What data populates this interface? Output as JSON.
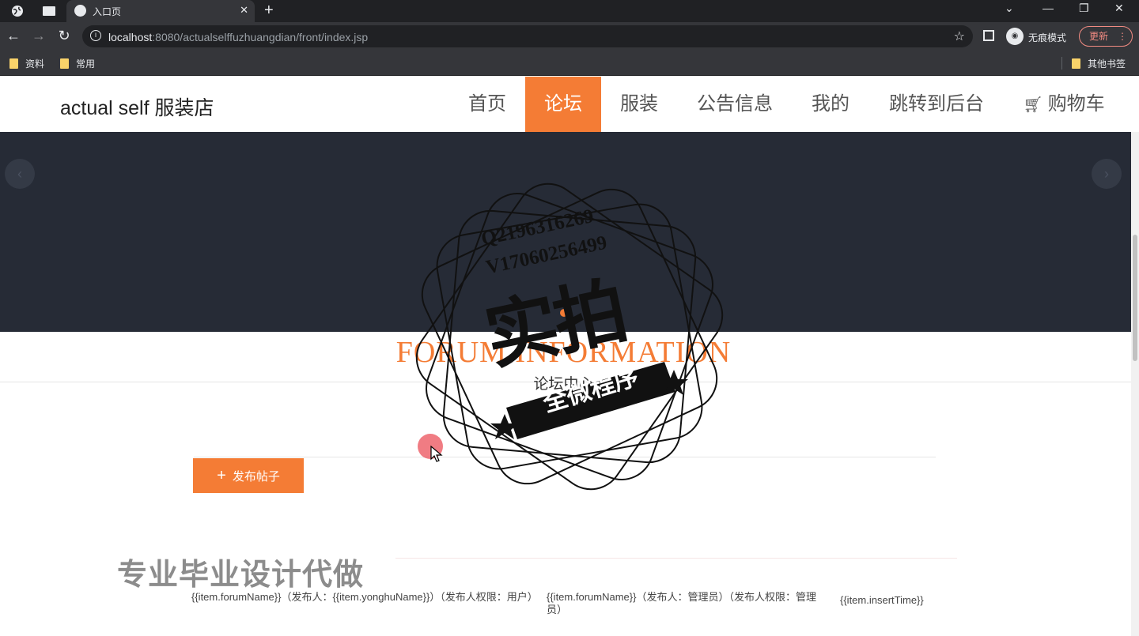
{
  "browser": {
    "tab_title": "入口页",
    "url_host": "localhost",
    "url_rest": ":8080/actualselffuzhuangdian/front/index.jsp",
    "incognito_label": "无痕模式",
    "update_label": "更新",
    "bookmarks": [
      "资料",
      "常用"
    ],
    "other_bookmarks": "其他书签"
  },
  "site": {
    "logo": "actual self 服装店",
    "nav": [
      "首页",
      "论坛",
      "服装",
      "公告信息",
      "我的",
      "跳转到后台",
      "购物车"
    ],
    "active_nav": "论坛"
  },
  "section": {
    "title_en": "FORUM INFORMATION",
    "title_cn": "论坛中心"
  },
  "publish_label": "发布帖子",
  "posts": [
    "{{item.forumName}}（发布人：{{item.yonghuName}}）（发布人权限：用户）",
    "{{item.forumName}}（发布人：管理员）（发布人权限：管理员）",
    "{{item.insertTime}}"
  ],
  "overlay": {
    "stamp_qq": "Q2196316269",
    "stamp_wx": "V17060256499",
    "stamp_main": "实拍",
    "stamp_ribbon": "全微程序",
    "watermark": "专业毕业设计代做"
  },
  "colors": {
    "accent": "#f47c35",
    "banner": "#262b36"
  }
}
